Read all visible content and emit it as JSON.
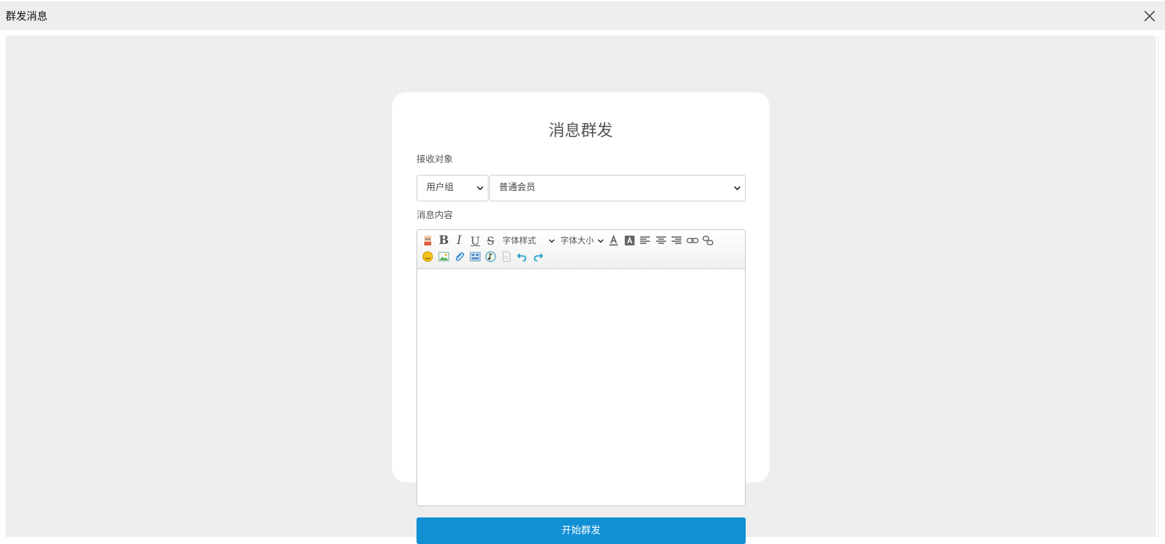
{
  "window": {
    "title": "群发消息",
    "close_icon": "close-icon"
  },
  "form": {
    "heading": "消息群发",
    "recipient_label": "接收对象",
    "recipient_type": {
      "selected": "用户组"
    },
    "recipient_group": {
      "selected": "普通会员"
    },
    "content_label": "消息内容",
    "editor": {
      "font_style_label": "字体样式",
      "font_size_label": "字体大小",
      "body": ""
    },
    "submit_label": "开始群发"
  },
  "colors": {
    "titlebar_bg": "#eeeeee",
    "frame_bg": "#eeeeee",
    "card_bg": "#ffffff",
    "button_bg": "#1190d4",
    "button_text": "#ffffff"
  }
}
